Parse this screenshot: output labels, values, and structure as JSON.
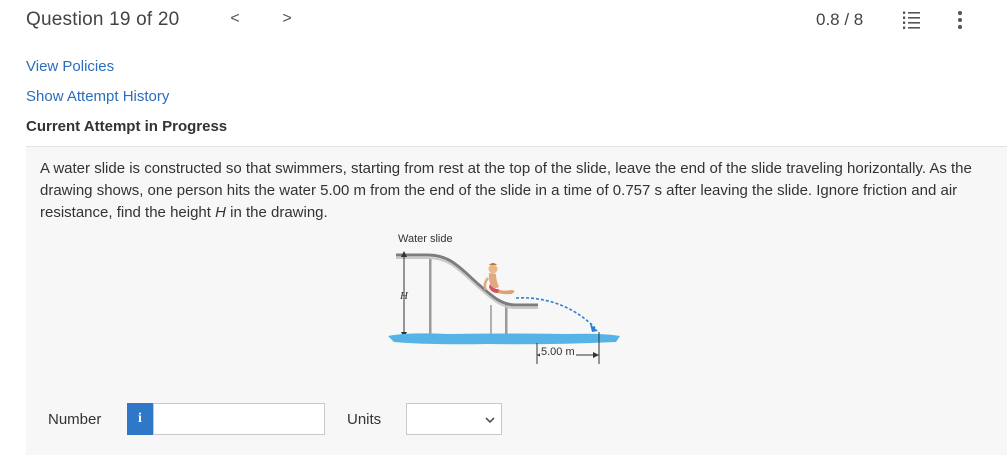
{
  "header": {
    "question_label": "Question 19 of 20",
    "prev_symbol": "<",
    "next_symbol": ">",
    "score": "0.8 / 8",
    "list_icon": "numbered-list-icon",
    "more_icon": "vertical-ellipsis-icon"
  },
  "links": {
    "view_policies": "View Policies",
    "show_attempt_history": "Show Attempt History"
  },
  "attempt_status": "Current Attempt in Progress",
  "question": {
    "text_1": "A water slide is constructed so that swimmers, starting from rest at the top of the slide, leave the end of the slide traveling horizontally. As the drawing shows, one person hits the water 5.00 m from the end of the slide in a time of 0.757 s after leaving the slide. Ignore friction and air resistance, find the height ",
    "text_var": "H",
    "text_2": " in the drawing."
  },
  "figure": {
    "caption": "Water slide",
    "height_label": "H",
    "distance_label": "5.00 m",
    "water_color": "#56b3e6",
    "trajectory_color": "#2a7fd4"
  },
  "answer": {
    "number_label": "Number",
    "info_symbol": "i",
    "number_value": "",
    "units_label": "Units",
    "units_value": ""
  },
  "colors": {
    "link": "#2a6ebb",
    "info_button": "#2f77c7",
    "panel_background": "#f7f7f7"
  }
}
